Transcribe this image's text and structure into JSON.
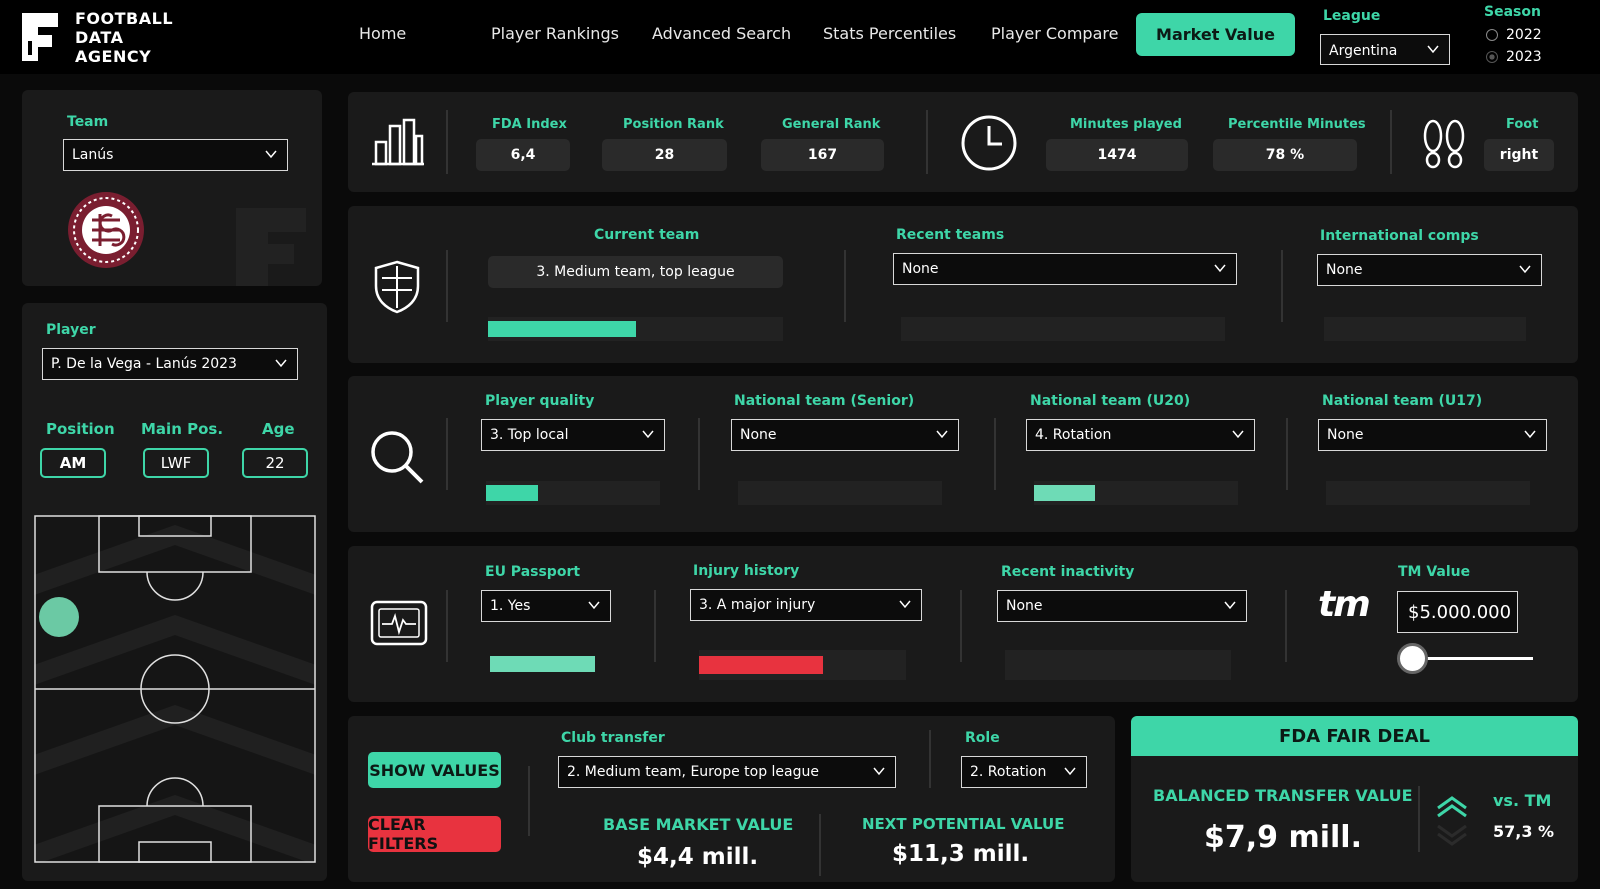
{
  "brand": {
    "line1": "FOOTBALL",
    "line2": "DATA",
    "line3": "AGENCY"
  },
  "nav": {
    "home": "Home",
    "rankings": "Player Rankings",
    "search": "Advanced Search",
    "percentiles": "Stats Percentiles",
    "compare": "Player Compare",
    "market": "Market Value"
  },
  "league": {
    "label": "League",
    "value": "Argentina"
  },
  "season": {
    "label": "Season",
    "opt1": "2022",
    "opt2": "2023"
  },
  "team": {
    "label": "Team",
    "value": "Lanús"
  },
  "player": {
    "label": "Player",
    "value": "P. De la Vega - Lanús 2023"
  },
  "position": {
    "label": "Position",
    "value": "AM",
    "main_label": "Main Pos.",
    "main_value": "LWF",
    "age_label": "Age",
    "age_value": "22"
  },
  "stats": {
    "fda_index_label": "FDA Index",
    "fda_index": "6,4",
    "pos_rank_label": "Position Rank",
    "pos_rank": "28",
    "gen_rank_label": "General Rank",
    "gen_rank": "167",
    "minutes_label": "Minutes played",
    "minutes": "1474",
    "pct_minutes_label": "Percentile Minutes",
    "pct_minutes": "78 %",
    "foot_label": "Foot",
    "foot": "right"
  },
  "teams": {
    "current_label": "Current team",
    "current": "3. Medium team, top league",
    "current_fill": 0.5,
    "recent_label": "Recent teams",
    "recent": "None",
    "intl_label": "International comps",
    "intl": "None"
  },
  "quality": {
    "player_label": "Player quality",
    "player": "3. Top local",
    "player_fill": 0.3,
    "senior_label": "National team (Senior)",
    "senior": "None",
    "u20_label": "National team (U20)",
    "u20": "4. Rotation",
    "u20_fill": 0.3,
    "u17_label": "National team (U17)",
    "u17": "None"
  },
  "other": {
    "passport_label": "EU Passport",
    "passport": "1. Yes",
    "passport_fill": 1.0,
    "injury_label": "Injury history",
    "injury": "3. A major injury",
    "injury_fill": 0.6,
    "inactivity_label": "Recent inactivity",
    "inactivity": "None",
    "tm_logo": "tm",
    "tm_label": "TM Value",
    "tm_value": "$5.000.000",
    "tm_slider": 0.0
  },
  "bottom": {
    "show_values": "SHOW VALUES",
    "clear_filters": "CLEAR FILTERS",
    "club_transfer_label": "Club transfer",
    "club_transfer": "2. Medium team, Europe top league",
    "role_label": "Role",
    "role": "2. Rotation",
    "base_label": "BASE MARKET VALUE",
    "base_value": "$4,4 mill.",
    "next_label": "NEXT POTENTIAL VALUE",
    "next_value": "$11,3 mill."
  },
  "fair": {
    "header": "FDA FAIR DEAL",
    "balanced_label": "BALANCED TRANSFER VALUE",
    "balanced_value": "$7,9 mill.",
    "vs_label": "vs. TM",
    "vs_value": "57,3 %"
  },
  "colors": {
    "accent": "#3ed6a8",
    "danger": "#e8333f",
    "panel": "#1a1a1a"
  }
}
